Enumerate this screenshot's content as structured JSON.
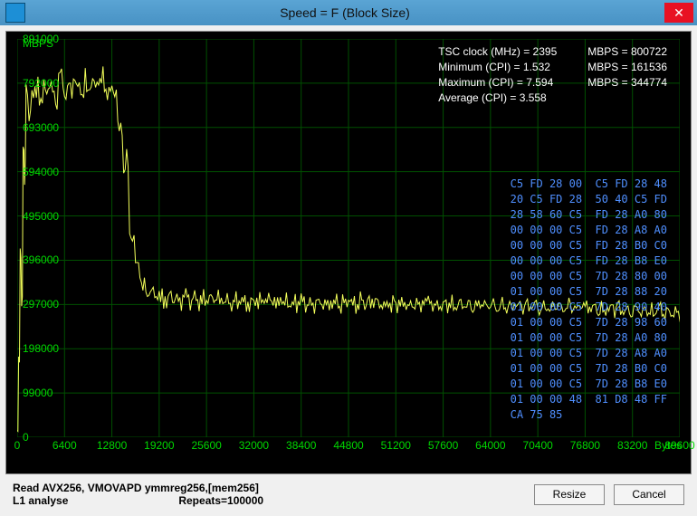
{
  "window": {
    "title": "Speed = F (Block Size)"
  },
  "buttons": {
    "close": "✕",
    "resize": "Resize",
    "cancel": "Cancel"
  },
  "axis": {
    "y_unit": "MBPS",
    "x_unit": "Bytes"
  },
  "y_ticks": [
    "891000",
    "792000",
    "693000",
    "594000",
    "495000",
    "396000",
    "297000",
    "198000",
    "99000",
    "0"
  ],
  "x_ticks": [
    "0",
    "6400",
    "12800",
    "19200",
    "25600",
    "32000",
    "38400",
    "44800",
    "51200",
    "57600",
    "64000",
    "70400",
    "76800",
    "83200",
    "89600"
  ],
  "stats_left": [
    "TSC clock (MHz) = 2395",
    "Minimum (CPI) = 1.532",
    "Maximum (CPI) = 7.594",
    "Average (CPI) = 3.558"
  ],
  "stats_right": [
    "MBPS = 800722",
    "MBPS = 161536",
    "MBPS = 344774"
  ],
  "hex_dump": [
    "C5 FD 28 00  C5 FD 28 48",
    "20 C5 FD 28  50 40 C5 FD",
    "28 58 60 C5  FD 28 A0 80",
    "00 00 00 C5  FD 28 A8 A0",
    "00 00 00 C5  FD 28 B0 C0",
    "00 00 00 C5  FD 28 B8 E0",
    "00 00 00 C5  7D 28 80 00",
    "01 00 00 C5  7D 28 88 20",
    "01 00 00 C5  7D 28 90 40",
    "01 00 00 C5  7D 28 98 60",
    "01 00 00 C5  7D 28 A0 80",
    "01 00 00 C5  7D 28 A8 A0",
    "01 00 00 C5  7D 28 B0 C0",
    "01 00 00 C5  7D 28 B8 E0",
    "01 00 00 48  81 D8 48 FF",
    "CA 75 85"
  ],
  "footer": {
    "line1": "Read AVX256, VMOVAPD ymmreg256,[mem256]",
    "line2_a": "L1 analyse",
    "line2_b": "Repeats=100000"
  },
  "chart_data": {
    "type": "line",
    "title": "Speed = F (Block Size)",
    "xlabel": "Bytes",
    "ylabel": "MBPS",
    "xlim": [
      0,
      89600
    ],
    "ylim": [
      0,
      891000
    ],
    "series": [
      {
        "name": "MBPS",
        "x": [
          0,
          200,
          400,
          600,
          800,
          1000,
          1200,
          1600,
          2000,
          2400,
          2800,
          3200,
          4000,
          4800,
          5600,
          6400,
          7200,
          8000,
          8800,
          9600,
          10400,
          11200,
          12000,
          12800,
          13600,
          14400,
          15200,
          16000,
          16800,
          17600,
          18400,
          19200,
          20800,
          22400,
          24000,
          25600,
          27200,
          28800,
          30400,
          32000,
          33600,
          35200,
          36800,
          38400,
          40000,
          41600,
          43200,
          44800,
          46400,
          48000,
          49600,
          51200,
          52800,
          54400,
          56000,
          57600,
          59200,
          60800,
          62400,
          64000,
          65600,
          67200,
          68800,
          70400,
          72000,
          73600,
          75200,
          76800,
          78400,
          80000,
          81600,
          83200,
          84800,
          86400,
          88000,
          89600
        ],
        "y": [
          20000,
          161536,
          420000,
          300000,
          650000,
          580000,
          760000,
          720000,
          770000,
          750000,
          780000,
          760000,
          785000,
          775000,
          790000,
          780000,
          792000,
          785000,
          788000,
          780000,
          790000,
          780000,
          785000,
          780000,
          700000,
          600000,
          450000,
          380000,
          340000,
          320000,
          312000,
          310000,
          308000,
          310000,
          306000,
          308000,
          305000,
          306000,
          304000,
          305000,
          303000,
          304000,
          302000,
          303000,
          301000,
          302000,
          300000,
          301000,
          299000,
          300000,
          298000,
          299000,
          297000,
          298000,
          296000,
          297000,
          295000,
          296000,
          294000,
          295000,
          292000,
          293000,
          291000,
          292000,
          290000,
          291000,
          288000,
          289000,
          286000,
          287000,
          284000,
          285000,
          282000,
          283000,
          280000,
          278000
        ]
      }
    ]
  }
}
